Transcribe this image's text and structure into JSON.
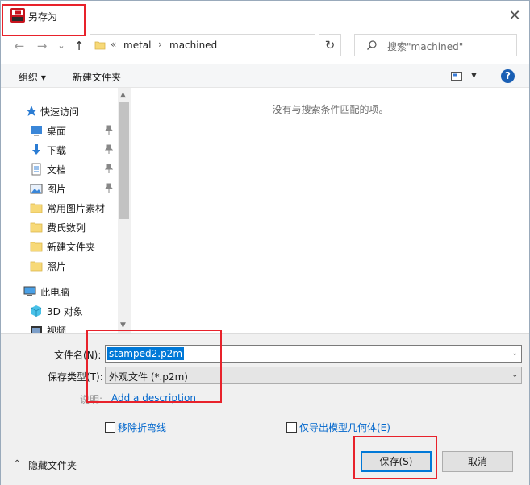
{
  "window": {
    "title": "另存为",
    "close_glyph": "✕"
  },
  "nav": {
    "back_glyph": "←",
    "forward_glyph": "→",
    "recent_glyph": "⌄",
    "up_glyph": "↑",
    "path_prefix": "«",
    "path": [
      "metal",
      "machined"
    ],
    "path_sep": "›",
    "refresh_glyph": "↻",
    "search_placeholder": "搜索\"machined\""
  },
  "toolbar": {
    "organize_label": "组织 ▾",
    "new_folder_label": "新建文件夹",
    "help_glyph": "?"
  },
  "sidebar": {
    "items": [
      {
        "label": "快速访问",
        "icon": "star-icon"
      },
      {
        "label": "桌面",
        "icon": "desktop-icon",
        "pinned": true
      },
      {
        "label": "下载",
        "icon": "download-icon",
        "pinned": true
      },
      {
        "label": "文档",
        "icon": "document-icon",
        "pinned": true
      },
      {
        "label": "图片",
        "icon": "pictures-icon",
        "pinned": true
      },
      {
        "label": "常用图片素材",
        "icon": "folder-icon"
      },
      {
        "label": "费氏数列",
        "icon": "folder-icon"
      },
      {
        "label": "新建文件夹",
        "icon": "folder-icon"
      },
      {
        "label": "照片",
        "icon": "folder-icon"
      },
      {
        "label": "此电脑",
        "icon": "computer-icon"
      },
      {
        "label": "3D 对象",
        "icon": "3d-objects-icon"
      },
      {
        "label": "视频",
        "icon": "video-icon"
      }
    ]
  },
  "content": {
    "empty_message": "没有与搜索条件匹配的项。"
  },
  "form": {
    "filename_label": "文件名(N):",
    "filename_value": "stamped2.p2m",
    "filetype_label": "保存类型(T):",
    "filetype_value": "外观文件 (*.p2m)",
    "description_label": "说明:",
    "description_link": "Add a description",
    "remove_creases_label": "移除折弯线",
    "remove_creases_checked": false,
    "export_geometry_only_label": "仅导出模型几何体(E)",
    "export_geometry_only_checked": false
  },
  "footer": {
    "hide_folders_label": "隐藏文件夹",
    "hide_folders_glyph": "⌃",
    "save_label": "保存(S)",
    "cancel_label": "取消"
  },
  "colors": {
    "accent": "#0078d7",
    "link": "#0066cc",
    "annotation": "#e8222b"
  }
}
